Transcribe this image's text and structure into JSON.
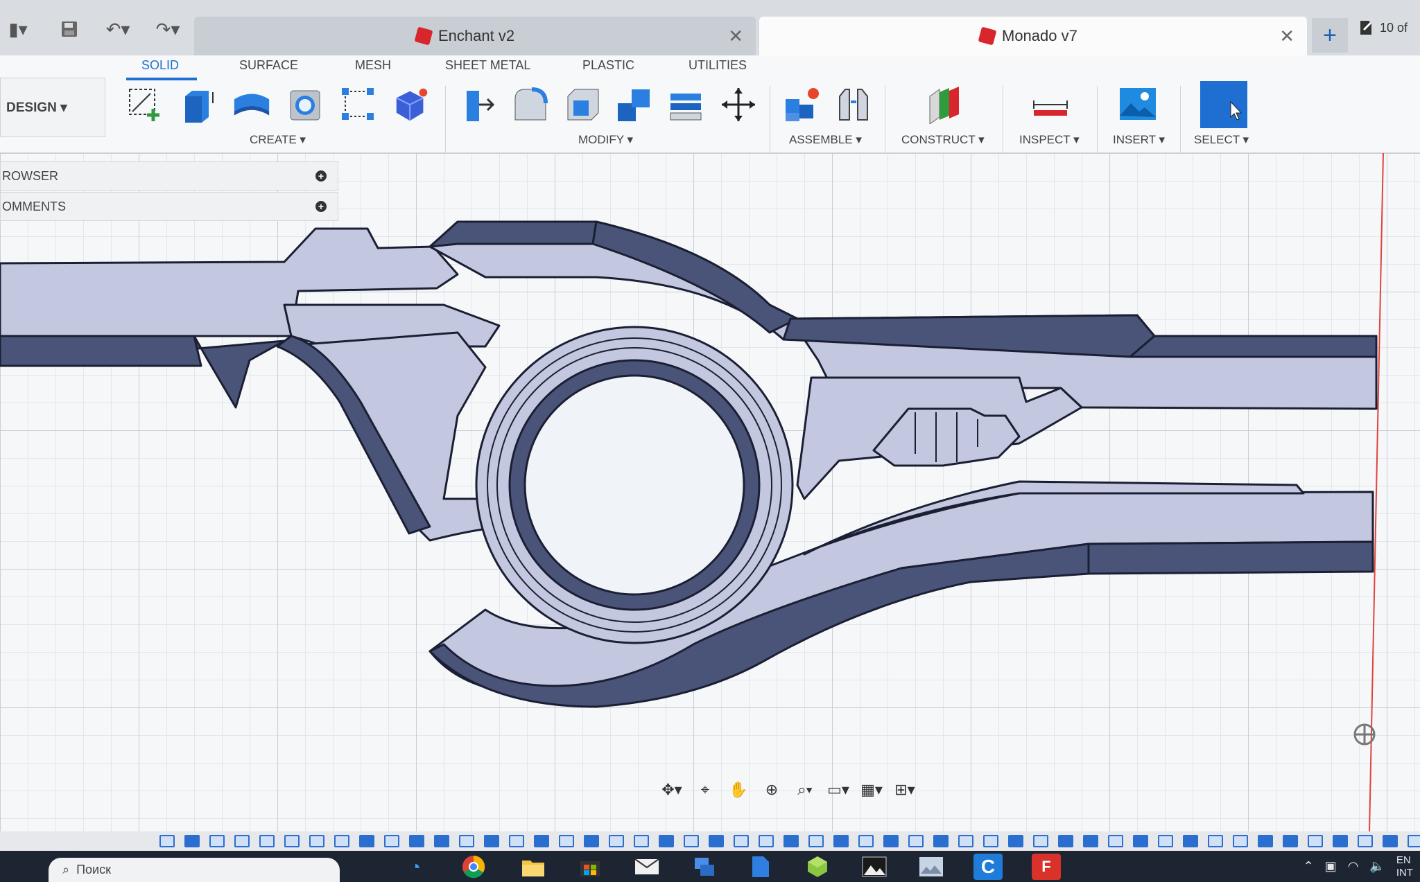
{
  "tabs": [
    {
      "label": "Enchant v2",
      "active": false
    },
    {
      "label": "Monado v7",
      "active": true
    }
  ],
  "jobs_label": "10 of",
  "workspace_button": "DESIGN ▾",
  "ribbon_tabs": [
    "SOLID",
    "SURFACE",
    "MESH",
    "SHEET METAL",
    "PLASTIC",
    "UTILITIES"
  ],
  "groups": {
    "create": "CREATE ▾",
    "modify": "MODIFY ▾",
    "assemble": "ASSEMBLE ▾",
    "construct": "CONSTRUCT ▾",
    "inspect": "INSPECT ▾",
    "insert": "INSERT ▾",
    "select": "SELECT ▾"
  },
  "panels": {
    "browser": "ROWSER",
    "comments": "OMMENTS"
  },
  "taskbar": {
    "search_placeholder": "Поиск"
  },
  "tray": {
    "lang_top": "EN",
    "lang_bottom": "INT"
  },
  "colors": {
    "accent": "#1e6fd1",
    "model_face": "#c3c8e0",
    "model_side": "#4a5478",
    "model_edge": "#1a1f33",
    "brand_red": "#d8262c"
  }
}
